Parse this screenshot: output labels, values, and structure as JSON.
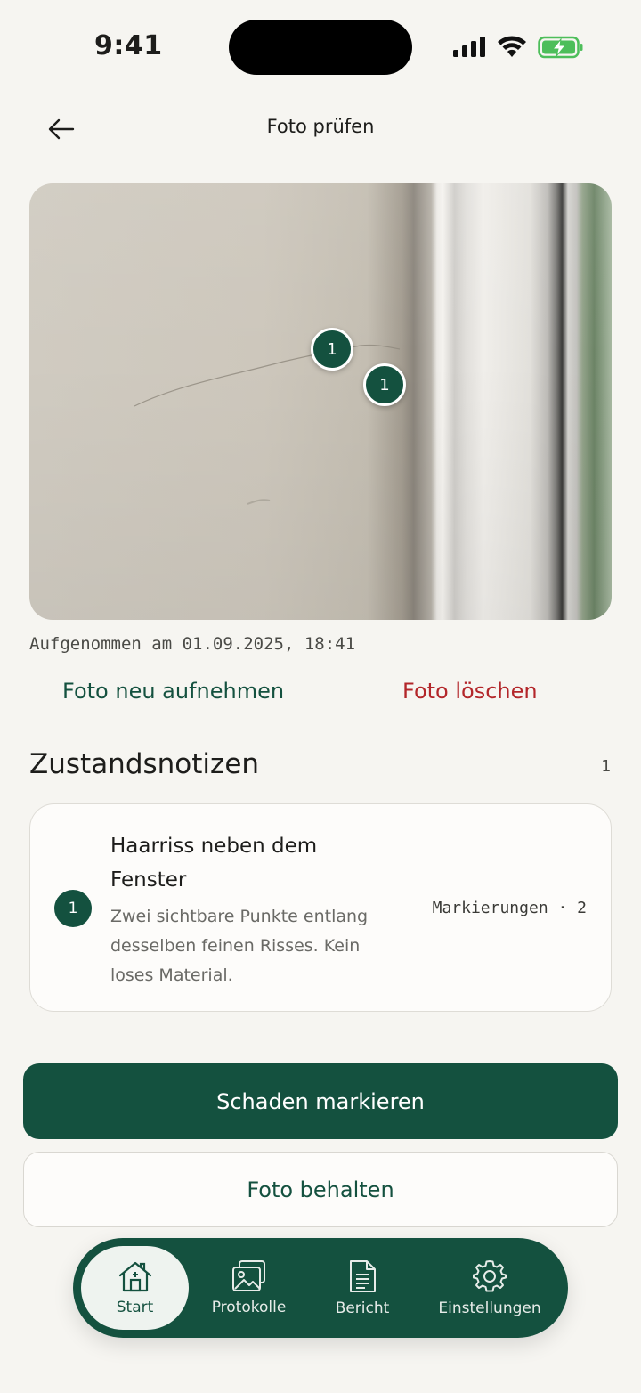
{
  "status": {
    "time": "9:41"
  },
  "header": {
    "title": "Foto prüfen"
  },
  "photo": {
    "caption": "Aufgenommen am 01.09.2025, 18:41",
    "markers": [
      "1",
      "1"
    ]
  },
  "actions": {
    "retake": "Foto neu aufnehmen",
    "delete": "Foto löschen"
  },
  "notes": {
    "title": "Zustandsnotizen",
    "count": "1",
    "items": [
      {
        "badge": "1",
        "title": "Haarriss neben dem Fenster",
        "text": "Zwei sichtbare Punkte entlang desselben feinen Risses. Kein loses Material.",
        "meta": "Markierungen · 2"
      }
    ]
  },
  "buttons": {
    "primary": "Schaden markieren",
    "secondary": "Foto behalten"
  },
  "nav": {
    "items": [
      {
        "label": "Start",
        "icon": "house-icon"
      },
      {
        "label": "Protokolle",
        "icon": "photos-icon"
      },
      {
        "label": "Bericht",
        "icon": "document-icon"
      },
      {
        "label": "Einstellungen",
        "icon": "gear-icon"
      }
    ],
    "active": "Start"
  },
  "colors": {
    "accent": "#14513f",
    "danger": "#b3262a",
    "background": "#f6f5f1"
  }
}
